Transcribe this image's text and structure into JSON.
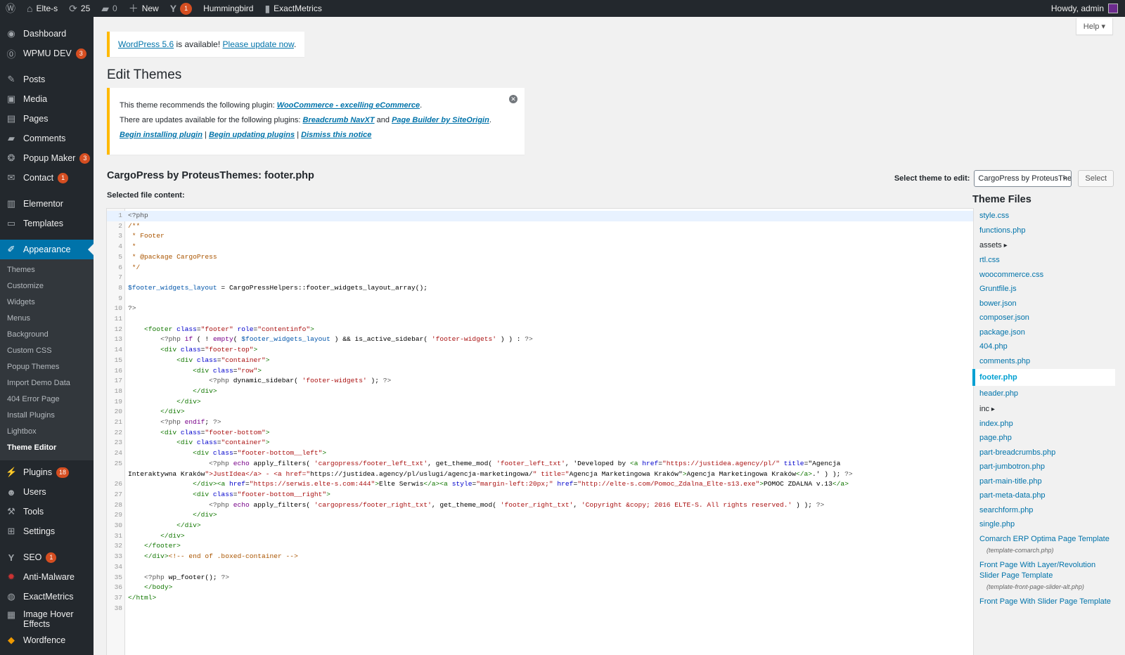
{
  "adminbar": {
    "site": "Elte-s",
    "updates_count": "25",
    "comments_count": "0",
    "new_label": "New",
    "yoast_count": "1",
    "hummingbird": "Hummingbird",
    "exactmetrics": "ExactMetrics",
    "howdy": "Howdy, admin"
  },
  "sidebar": {
    "items": [
      {
        "label": "Dashboard",
        "icon": "dashboard-icon"
      },
      {
        "label": "WPMU DEV",
        "icon": "wpmudev-icon",
        "count": "3"
      },
      {
        "label": "Posts",
        "icon": "pin-icon"
      },
      {
        "label": "Media",
        "icon": "media-icon"
      },
      {
        "label": "Pages",
        "icon": "pages-icon"
      },
      {
        "label": "Comments",
        "icon": "comment-icon"
      },
      {
        "label": "Popup Maker",
        "icon": "popup-icon",
        "count": "3"
      },
      {
        "label": "Contact",
        "icon": "mail-icon",
        "count": "1"
      },
      {
        "label": "Elementor",
        "icon": "elementor-icon"
      },
      {
        "label": "Templates",
        "icon": "folder-icon"
      },
      {
        "label": "Appearance",
        "icon": "brush-icon"
      },
      {
        "label": "Plugins",
        "icon": "plug-icon",
        "count": "18"
      },
      {
        "label": "Users",
        "icon": "user-icon"
      },
      {
        "label": "Tools",
        "icon": "wrench-icon"
      },
      {
        "label": "Settings",
        "icon": "settings-icon"
      },
      {
        "label": "SEO",
        "icon": "yoast-icon",
        "count": "1"
      },
      {
        "label": "Anti-Malware",
        "icon": "shield-icon"
      },
      {
        "label": "ExactMetrics",
        "icon": "chart-icon"
      },
      {
        "label": "Image Hover Effects",
        "icon": "image-icon"
      },
      {
        "label": "Wordfence",
        "icon": "wordfence-icon"
      }
    ],
    "submenu": [
      "Themes",
      "Customize",
      "Widgets",
      "Menus",
      "Background",
      "Custom CSS",
      "Popup Themes",
      "Import Demo Data",
      "404 Error Page",
      "Install Plugins",
      "Lightbox",
      "Theme Editor"
    ]
  },
  "help_label": "Help",
  "update_nag": {
    "version_link": "WordPress 5.6",
    "middle": " is available! ",
    "update_link": "Please update now",
    "end": "."
  },
  "page_title": "Edit Themes",
  "notice": {
    "line1_text": "This theme recommends the following plugin: ",
    "line1_link": "WooCommerce - excelling eCommerce",
    "line2_text": "There are updates available for the following plugins: ",
    "line2_link1": "Breadcrumb NavXT",
    "line2_and": " and ",
    "line2_link2": "Page Builder by SiteOrigin",
    "action1": "Begin installing plugin",
    "action2": "Begin updating plugins",
    "action3": "Dismiss this notice",
    "sep": " | "
  },
  "file_title": "CargoPress by ProteusThemes: footer.php",
  "selected_file_label": "Selected file content:",
  "select_theme_label": "Select theme to edit:",
  "select_theme_value": "CargoPress by ProteusThemes",
  "select_button": "Select",
  "theme_files_heading": "Theme Files",
  "theme_files": [
    {
      "name": "style.css"
    },
    {
      "name": "functions.php"
    },
    {
      "name": "assets",
      "folder": true
    },
    {
      "name": "rtl.css"
    },
    {
      "name": "woocommerce.css"
    },
    {
      "name": "Gruntfile.js"
    },
    {
      "name": "bower.json"
    },
    {
      "name": "composer.json"
    },
    {
      "name": "package.json"
    },
    {
      "name": "404.php"
    },
    {
      "name": "comments.php"
    },
    {
      "name": "footer.php",
      "current": true
    },
    {
      "name": "header.php"
    },
    {
      "name": "inc",
      "folder": true
    },
    {
      "name": "index.php"
    },
    {
      "name": "page.php"
    },
    {
      "name": "part-breadcrumbs.php"
    },
    {
      "name": "part-jumbotron.php"
    },
    {
      "name": "part-main-title.php"
    },
    {
      "name": "part-meta-data.php"
    },
    {
      "name": "searchform.php"
    },
    {
      "name": "single.php"
    },
    {
      "name": "Comarch ERP Optima Page Template",
      "sub": "(template-comarch.php)"
    },
    {
      "name": "Front Page With Layer/Revolution Slider Page Template",
      "sub": "(template-front-page-slider-alt.php)"
    },
    {
      "name": "Front Page With Slider Page Template"
    }
  ],
  "code_lines": [
    {
      "n": "1",
      "t": "<?php"
    },
    {
      "n": "2",
      "t": "/**"
    },
    {
      "n": "3",
      "t": " * Footer"
    },
    {
      "n": "4",
      "t": " *"
    },
    {
      "n": "5",
      "t": " * @package CargoPress"
    },
    {
      "n": "6",
      "t": " */"
    },
    {
      "n": "7",
      "t": ""
    },
    {
      "n": "8",
      "t": "$footer_widgets_layout = CargoPressHelpers::footer_widgets_layout_array();"
    },
    {
      "n": "9",
      "t": ""
    },
    {
      "n": "10",
      "t": "?>"
    },
    {
      "n": "11",
      "t": ""
    },
    {
      "n": "12",
      "t": "    <footer class=\"footer\" role=\"contentinfo\">"
    },
    {
      "n": "13",
      "t": "        <?php if ( ! empty( $footer_widgets_layout ) && is_active_sidebar( 'footer-widgets' ) ) : ?>"
    },
    {
      "n": "14",
      "t": "        <div class=\"footer-top\">"
    },
    {
      "n": "15",
      "t": "            <div class=\"container\">"
    },
    {
      "n": "16",
      "t": "                <div class=\"row\">"
    },
    {
      "n": "17",
      "t": "                    <?php dynamic_sidebar( 'footer-widgets' ); ?>"
    },
    {
      "n": "18",
      "t": "                </div>"
    },
    {
      "n": "19",
      "t": "            </div>"
    },
    {
      "n": "20",
      "t": "        </div>"
    },
    {
      "n": "21",
      "t": "        <?php endif; ?>"
    },
    {
      "n": "22",
      "t": "        <div class=\"footer-bottom\">"
    },
    {
      "n": "23",
      "t": "            <div class=\"container\">"
    },
    {
      "n": "24",
      "t": "                <div class=\"footer-bottom__left\">"
    },
    {
      "n": "25",
      "t": "                    <?php echo apply_filters( 'cargopress/footer_left_txt', get_theme_mod( 'footer_left_txt', 'Developed by <a href=\"https://justidea.agency/pl/\" title=\"Agencja"
    },
    {
      "n": "",
      "t": "Interaktywna Kraków\">JustIdea</a> - <a href=\"https://justidea.agency/pl/uslugi/agencja-marketingowa/\" title=\"Agencja Marketingowa Kraków\">Agencja Marketingowa Kraków</a>.' ) ); ?>"
    },
    {
      "n": "26",
      "t": "                </div><a href=\"https://serwis.elte-s.com:444\">Elte Serwis</a><a style=\"margin-left:20px;\" href=\"http://elte-s.com/Pomoc_Zdalna_Elte-s13.exe\">POMOC ZDALNA v.13</a>"
    },
    {
      "n": "27",
      "t": "                <div class=\"footer-bottom__right\">"
    },
    {
      "n": "28",
      "t": "                    <?php echo apply_filters( 'cargopress/footer_right_txt', get_theme_mod( 'footer_right_txt', 'Copyright &copy; 2016 ELTE-S. All rights reserved.' ) ); ?>"
    },
    {
      "n": "29",
      "t": "                </div>"
    },
    {
      "n": "30",
      "t": "            </div>"
    },
    {
      "n": "31",
      "t": "        </div>"
    },
    {
      "n": "32",
      "t": "    </footer>"
    },
    {
      "n": "33",
      "t": "    </div><!-- end of .boxed-container -->"
    },
    {
      "n": "34",
      "t": ""
    },
    {
      "n": "35",
      "t": "    <?php wp_footer(); ?>"
    },
    {
      "n": "36",
      "t": "    </body>"
    },
    {
      "n": "37",
      "t": "</html>"
    },
    {
      "n": "38",
      "t": ""
    }
  ]
}
